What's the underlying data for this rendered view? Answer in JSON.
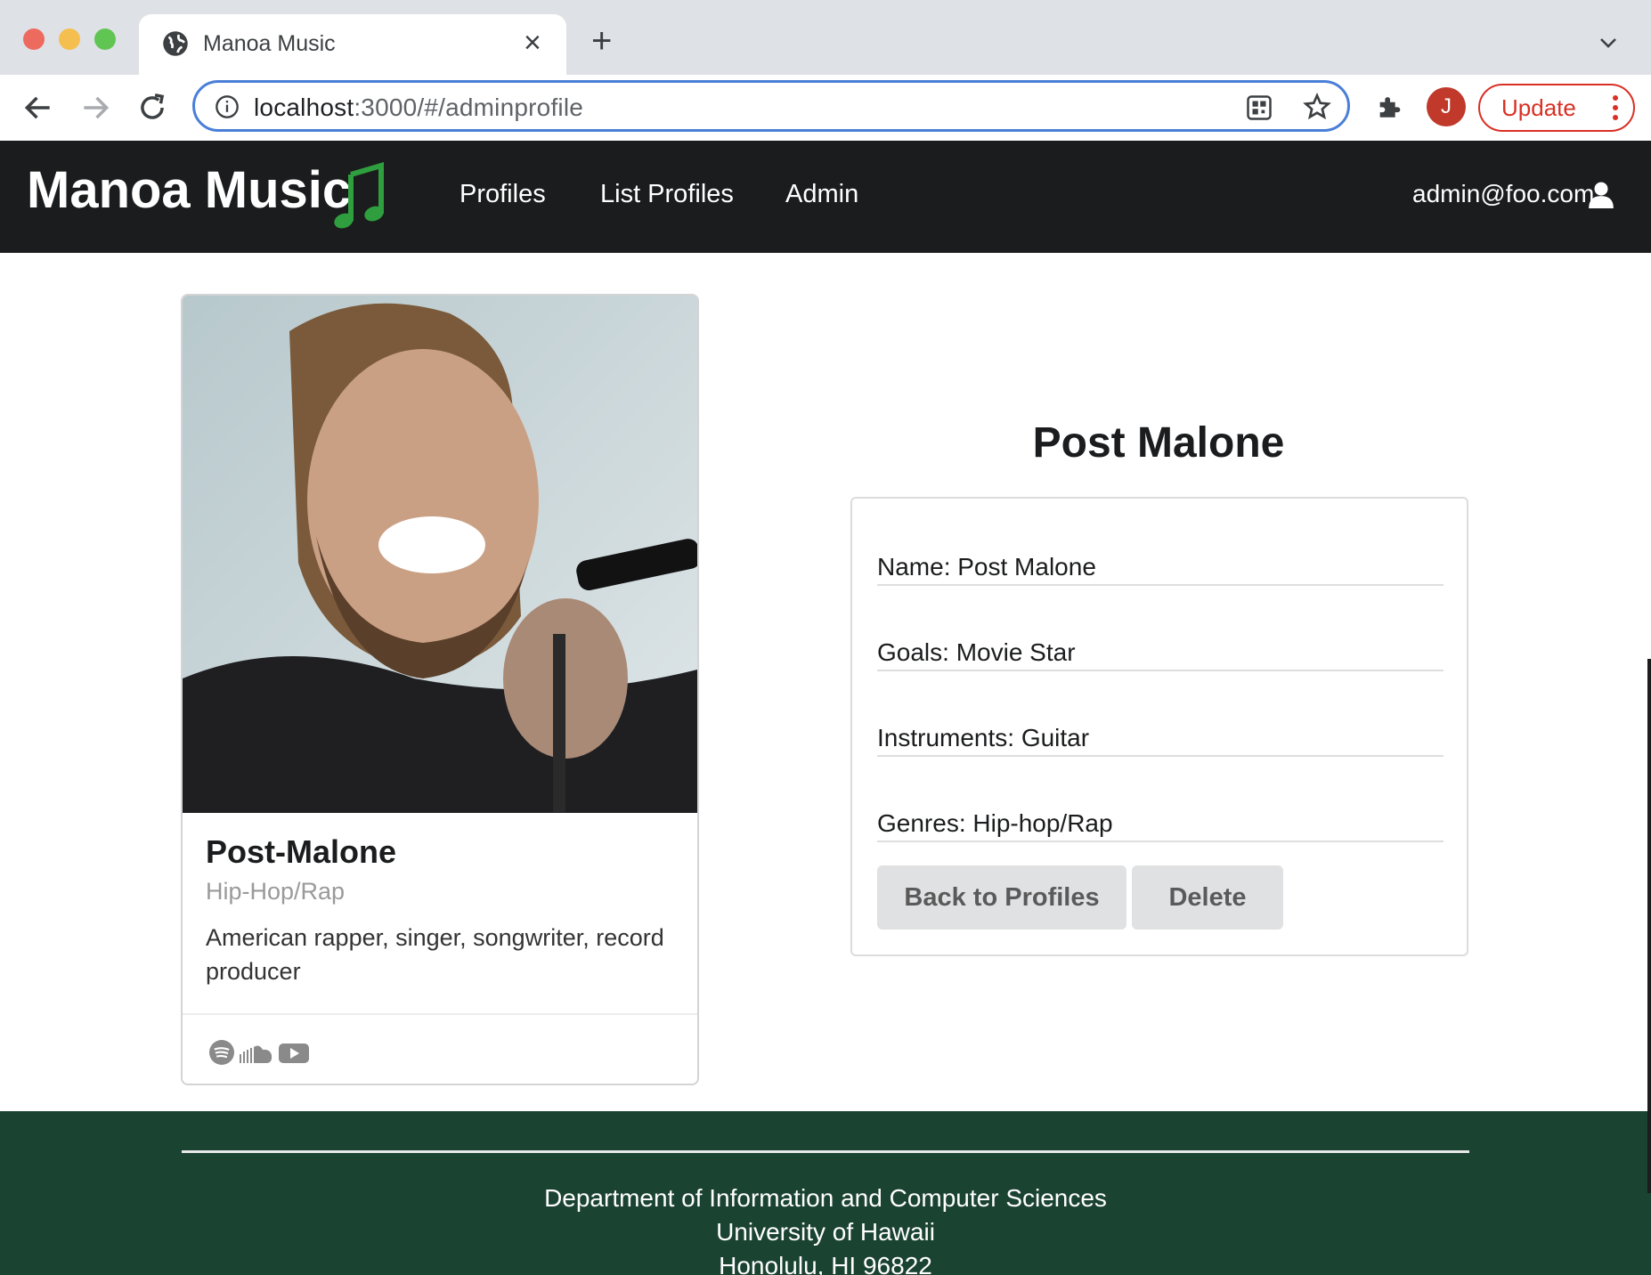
{
  "browser": {
    "tab_title": "Manoa Music",
    "url_host": "localhost",
    "url_rest": ":3000/#/adminprofile",
    "avatar_letter": "J",
    "update_label": "Update"
  },
  "navbar": {
    "brand": "Manoa Music",
    "links": [
      "Profiles",
      "List Profiles",
      "Admin"
    ],
    "user_email": "admin@foo.com"
  },
  "card": {
    "header": "Post-Malone",
    "meta": "Hip-Hop/Rap",
    "description": "American rapper, singer, songwriter, record producer",
    "social_icons": [
      "spotify-icon",
      "soundcloud-icon",
      "youtube-icon"
    ]
  },
  "profile": {
    "title": "Post Malone",
    "name": "Name: Post Malone",
    "goals": "Goals: Movie Star",
    "instruments": "Instruments: Guitar",
    "genres": "Genres: Hip-hop/Rap",
    "back_label": "Back to Profiles",
    "delete_label": "Delete"
  },
  "footer": {
    "line1": "Department of Information and Computer Sciences",
    "line2": "University of Hawaii",
    "line3": "Honolulu, HI 96822"
  },
  "colors": {
    "navbar_bg": "#1b1c1d",
    "footer_bg": "#1b4332",
    "brand_note": "#2e9e3e",
    "update_red": "#d93025",
    "omnibox_focus": "#4a7fd8"
  }
}
